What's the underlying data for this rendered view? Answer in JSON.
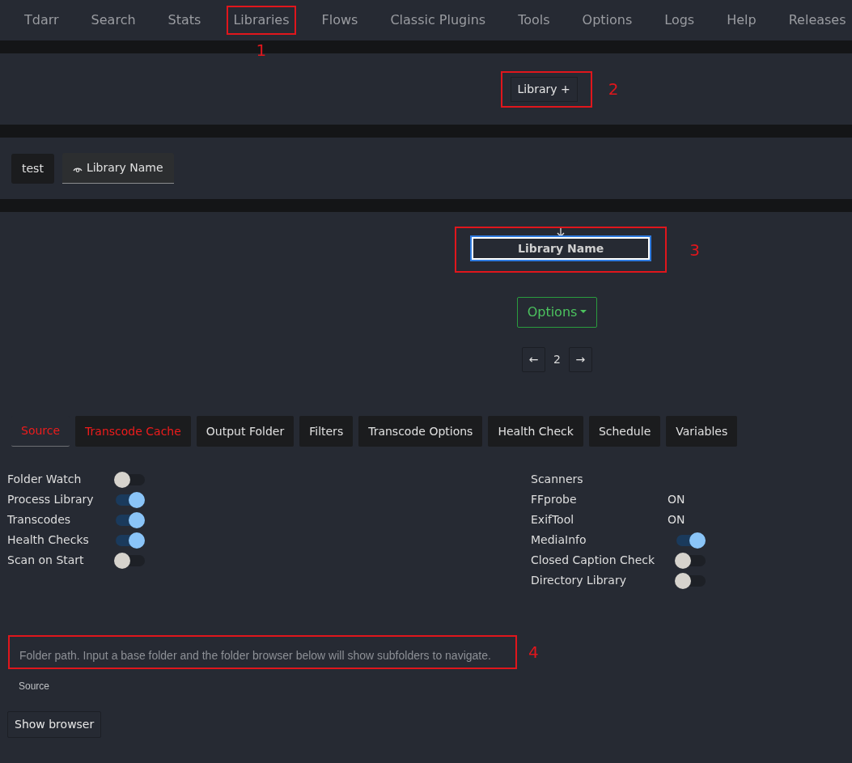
{
  "nav": {
    "items": [
      {
        "label": "Tdarr"
      },
      {
        "label": "Search"
      },
      {
        "label": "Stats"
      },
      {
        "label": "Libraries",
        "callout": "1"
      },
      {
        "label": "Flows"
      },
      {
        "label": "Classic Plugins"
      },
      {
        "label": "Tools"
      },
      {
        "label": "Options"
      },
      {
        "label": "Logs"
      },
      {
        "label": "Help"
      },
      {
        "label": "Releases"
      }
    ]
  },
  "add_library_button": {
    "label": "Library +",
    "callout": "2"
  },
  "library_tabs": [
    {
      "label": "test",
      "selected": false
    },
    {
      "label": "Library Name",
      "selected": true
    }
  ],
  "library_name_field": {
    "value": "Library Name",
    "callout": "3"
  },
  "options_button": {
    "label": "Options"
  },
  "pager": {
    "prev": "←",
    "page": "2",
    "next": "→"
  },
  "settings_tabs": [
    {
      "label": "Source",
      "selected": true,
      "warning": true
    },
    {
      "label": "Transcode Cache",
      "selected": false,
      "warning": true
    },
    {
      "label": "Output Folder",
      "selected": false,
      "warning": false
    },
    {
      "label": "Filters",
      "selected": false,
      "warning": false
    },
    {
      "label": "Transcode Options",
      "selected": false,
      "warning": false
    },
    {
      "label": "Health Check",
      "selected": false,
      "warning": false
    },
    {
      "label": "Schedule",
      "selected": false,
      "warning": false
    },
    {
      "label": "Variables",
      "selected": false,
      "warning": false
    }
  ],
  "switches": [
    {
      "label": "Folder Watch",
      "on": false
    },
    {
      "label": "Process Library",
      "on": true
    },
    {
      "label": "Transcodes",
      "on": true
    },
    {
      "label": "Health Checks",
      "on": true
    },
    {
      "label": "Scan on Start",
      "on": false
    }
  ],
  "scanners": {
    "title": "Scanners",
    "rows": [
      {
        "kind": "text",
        "label": "FFprobe",
        "value": "ON"
      },
      {
        "kind": "text",
        "label": "ExifTool",
        "value": "ON"
      },
      {
        "kind": "toggle",
        "label": "MediaInfo",
        "on": true
      },
      {
        "kind": "toggle",
        "label": "Closed Caption Check",
        "on": false
      },
      {
        "kind": "toggle",
        "label": "Directory Library",
        "on": false
      }
    ]
  },
  "folder_field": {
    "placeholder": "Folder path. Input a base folder and the folder browser below will show subfolders to navigate.",
    "callout": "4"
  },
  "source_label": "Source",
  "show_browser_button": {
    "label": "Show browser"
  }
}
